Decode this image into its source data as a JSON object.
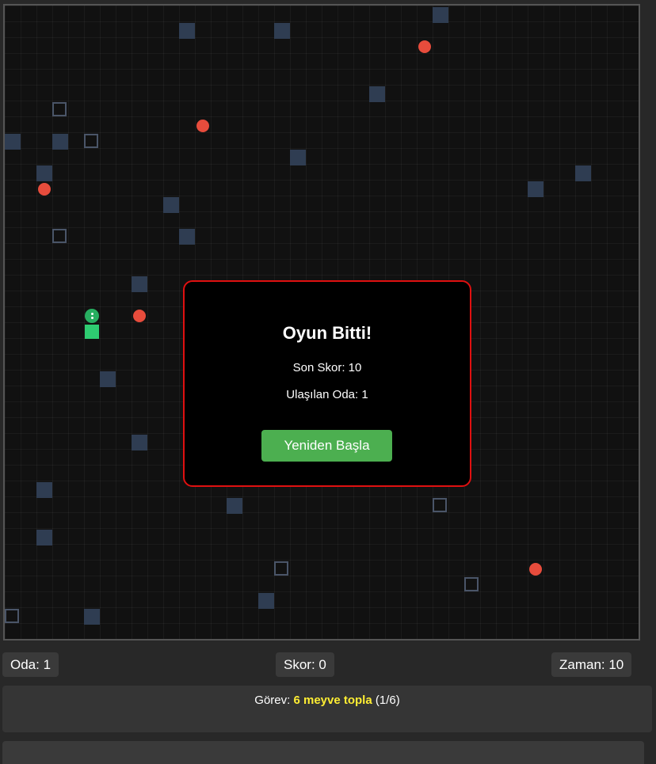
{
  "modal": {
    "title": "Oyun Bitti!",
    "final_score": "Son Skor: 10",
    "room_reached": "Ulaşılan Oda: 1",
    "restart_label": "Yeniden Başla"
  },
  "stats": {
    "room": "Oda: 1",
    "score": "Skor: 0",
    "time": "Zaman: 10"
  },
  "task": {
    "prefix": "Görev: ",
    "goal": "6 meyve topla",
    "progress": " (1/6)"
  },
  "colors": {
    "wall": "#2f3d52",
    "fruit": "#e74c3c",
    "snake": "#2ecc71",
    "modal_border": "#e01010",
    "button": "#4caf50",
    "task_goal": "#ffee33"
  },
  "icons": {
    "wall": "dark-blue-square",
    "ghost_wall": "outlined-square",
    "fruit": "red-circle",
    "snake_head": "green-circle-with-eyes",
    "snake_body": "green-square"
  }
}
